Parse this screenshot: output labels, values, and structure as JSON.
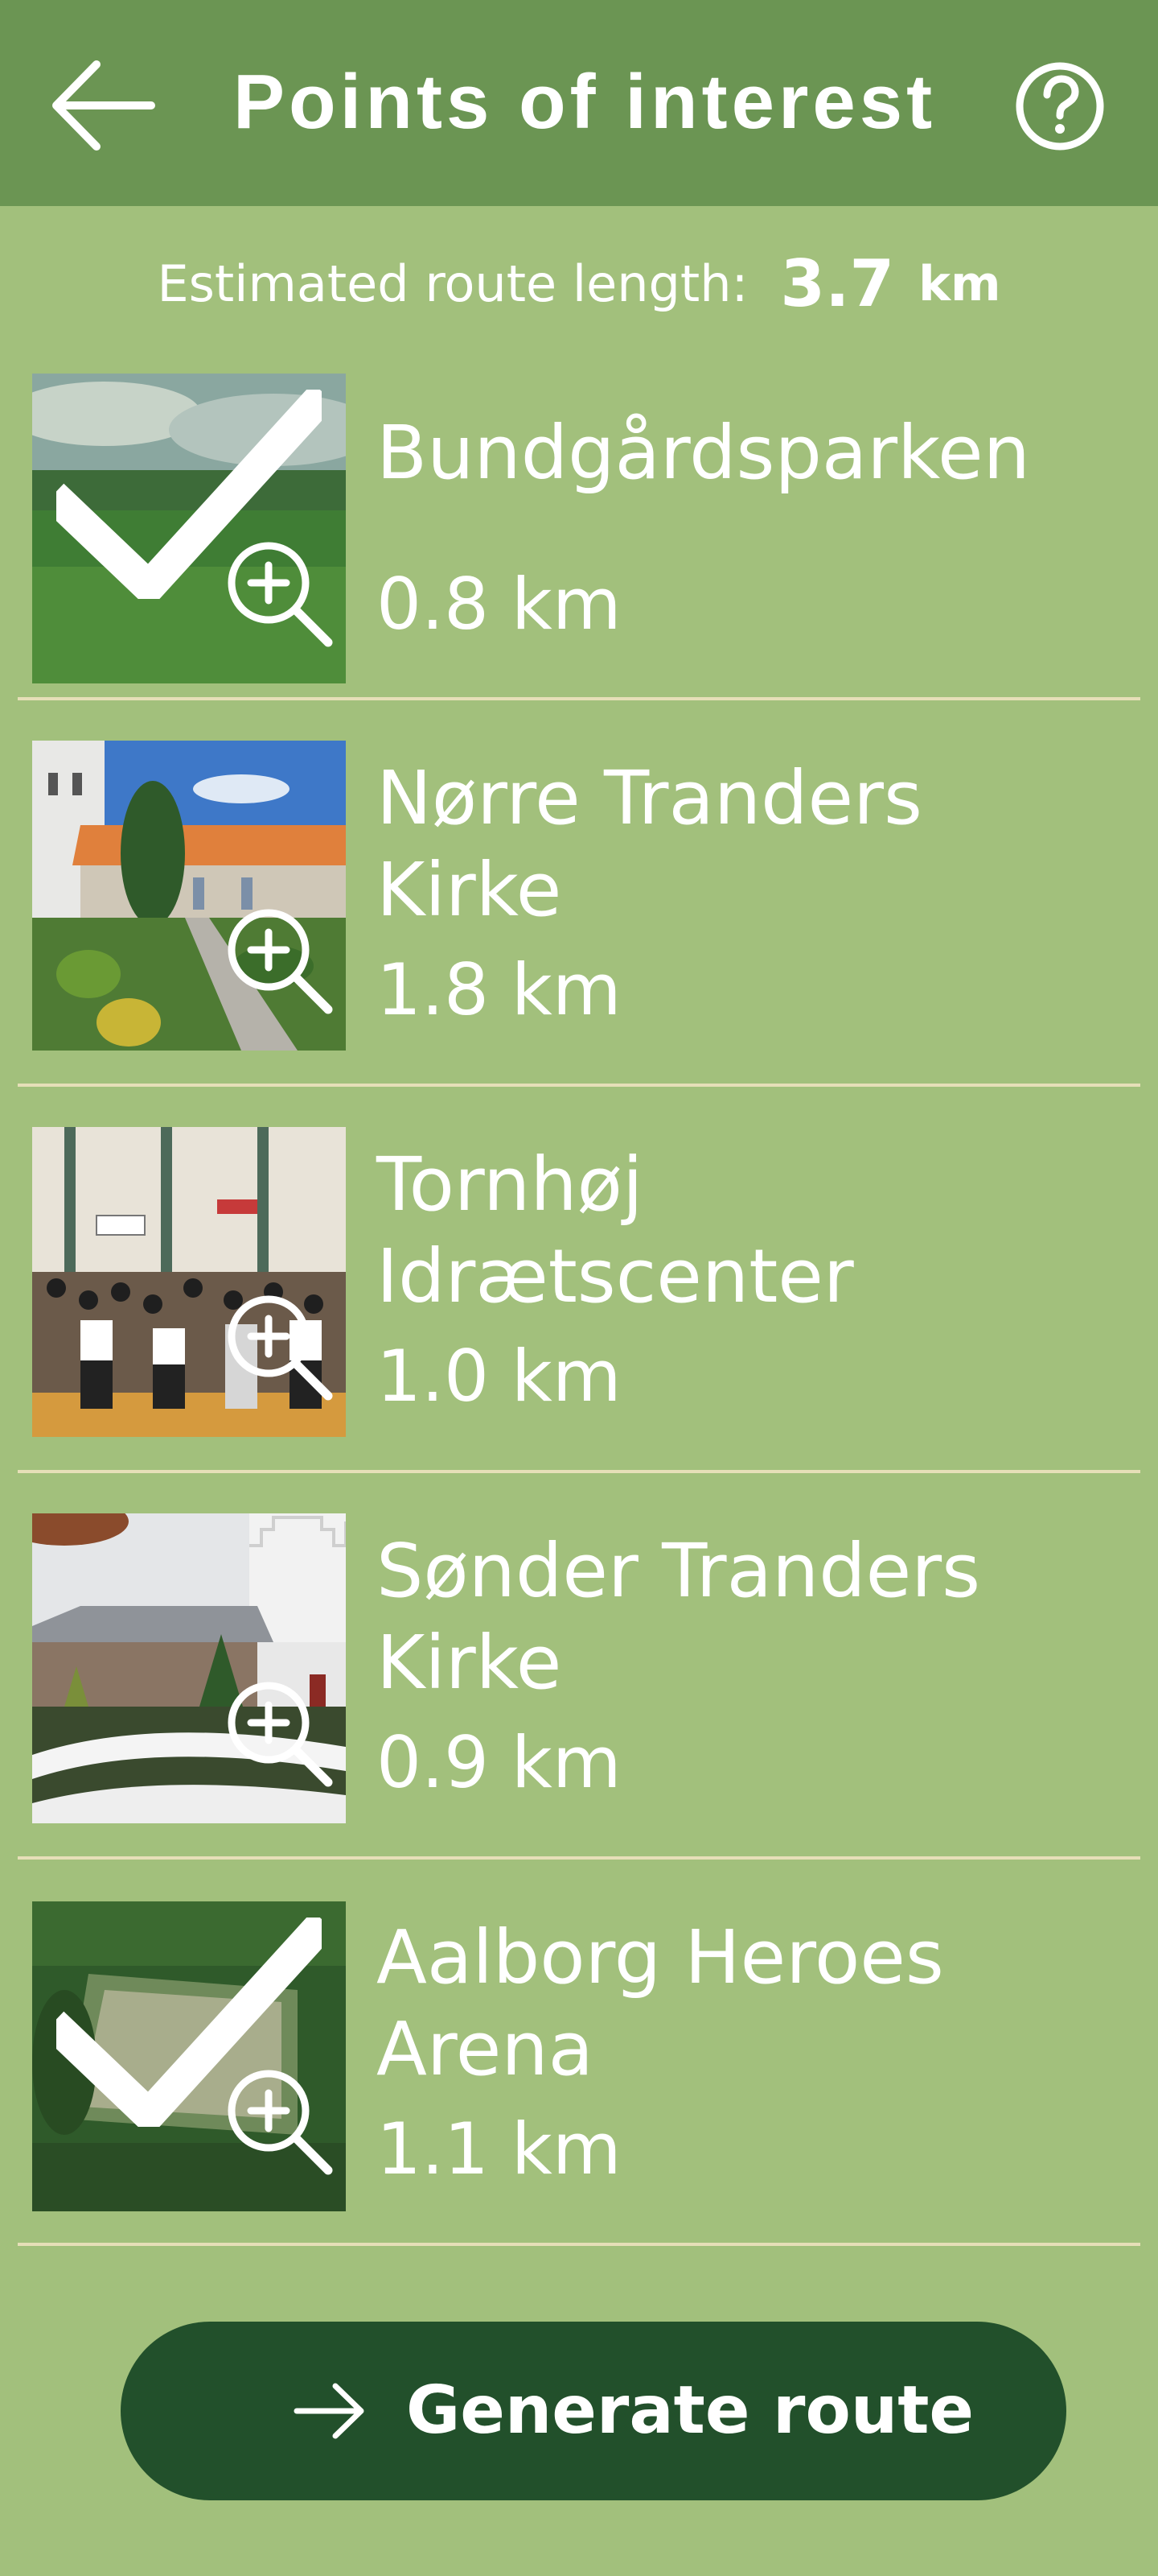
{
  "header": {
    "title": "Points of interest",
    "back_icon": "arrow-left-icon",
    "help_icon": "question-circle-icon",
    "background_color": "#6b9553"
  },
  "route": {
    "label": "Estimated route length:",
    "value": "3.7",
    "unit": "km"
  },
  "pois": [
    {
      "name": "Bundgårdsparken",
      "distance": "0.8 km",
      "selected": true,
      "thumbnail": "park-meadow"
    },
    {
      "name": "Nørre Tranders Kirke",
      "distance": "1.8 km",
      "selected": false,
      "thumbnail": "church-garden"
    },
    {
      "name": "Tornhøj Idrætscenter",
      "distance": "1.0 km",
      "selected": false,
      "thumbnail": "sports-hall-crowd"
    },
    {
      "name": "Sønder Tranders Kirke",
      "distance": "0.9 km",
      "selected": false,
      "thumbnail": "church-snow"
    },
    {
      "name": "Aalborg Heroes Arena",
      "distance": "1.1 km",
      "selected": true,
      "thumbnail": "aerial-field"
    }
  ],
  "actions": {
    "generate_label": "Generate route",
    "generate_icon": "arrow-right-icon",
    "button_color": "#22502b"
  },
  "colors": {
    "background": "#a2c07c",
    "divider": "#e6dfb8",
    "text": "#ffffff"
  }
}
